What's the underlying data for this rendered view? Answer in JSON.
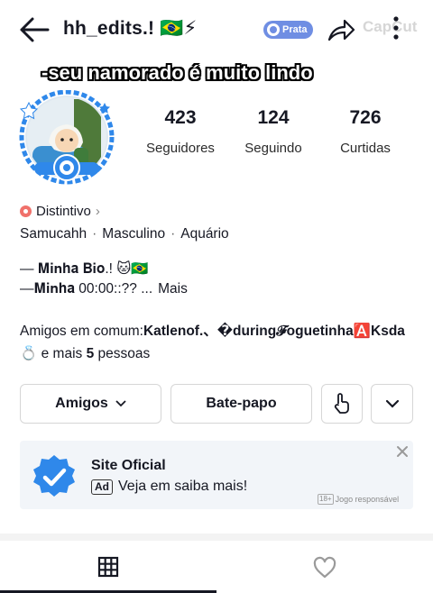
{
  "header": {
    "username": "hh_edits.! 🇧🇷⚡",
    "tier_badge": "Prata",
    "watermark": "CapCut"
  },
  "overlay": {
    "caption": "-seu namorado é muito lindo"
  },
  "stats": [
    {
      "value": "423",
      "label": "Seguidores"
    },
    {
      "value": "124",
      "label": "Seguindo"
    },
    {
      "value": "726",
      "label": "Curtidas"
    }
  ],
  "profile": {
    "badge_label": "Distintivo",
    "name": "Samucahh",
    "gender": "Masculino",
    "sign": "Aquário",
    "bio_line1": "— 𝐌𝐢𝐧𝐡𝐚 𝐁𝐢𝐨.! 🐱🇧🇷",
    "bio_line2": "—𝐌𝐢𝐧𝐡𝐚 00:00::?? ...",
    "more_label": "Mais",
    "mutual_prefix": "Amigos em comum:",
    "mutual_names": "Katlenof.、�during𝓕oguetinha🅰️Ksda💍",
    "mutual_suffix_1": " e mais ",
    "mutual_count": "5",
    "mutual_suffix_2": " pessoas"
  },
  "actions": {
    "friends_label": "Amigos",
    "chat_label": "Bate-papo"
  },
  "ad": {
    "title": "Site Oficial",
    "tag": "Ad",
    "subtitle": "Veja em saiba mais!",
    "age": "18+",
    "disclaimer": "Jogo responsável"
  },
  "tabs": {
    "active": "grid",
    "items": [
      "grid-icon",
      "heart-icon"
    ]
  },
  "colors": {
    "accent_blue": "#2f88ea",
    "tier_blue": "#6f8ee3",
    "badge_red": "#f0716b"
  }
}
